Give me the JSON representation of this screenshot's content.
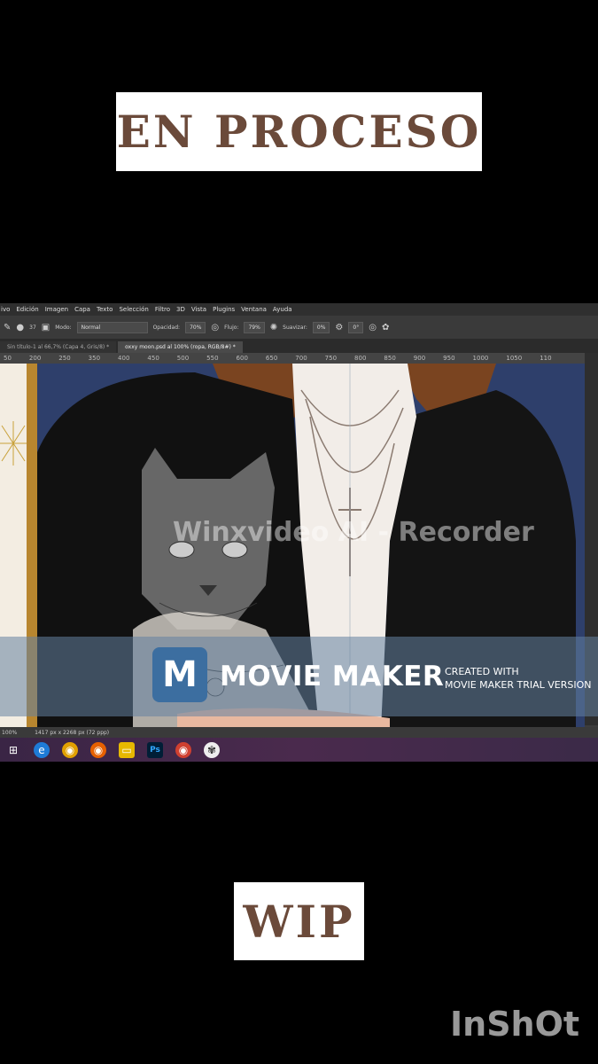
{
  "overlay": {
    "top_title": "EN PROCESO",
    "bottom_title": "WIP"
  },
  "photoshop": {
    "menu": [
      "ivo",
      "Edición",
      "Imagen",
      "Capa",
      "Texto",
      "Selección",
      "Filtro",
      "3D",
      "Vista",
      "Plugins",
      "Ventana",
      "Ayuda"
    ],
    "options": {
      "mode_label": "Modo:",
      "mode_value": "Normal",
      "opacity_label": "Opacidad:",
      "opacity_value": "70%",
      "flow_label": "Flujo:",
      "flow_value": "79%",
      "smoothing_label": "Suavizar:",
      "smoothing_value": "0%",
      "angle_value": "0°",
      "brush_size": "37"
    },
    "tabs": [
      {
        "label": "Sin título-1 al 66,7% (Capa 4, Gris/8) *",
        "active": false
      },
      {
        "label": "oxxy moon.psd al 100% (ropa, RGB/8#) *",
        "active": true
      }
    ],
    "ruler_ticks": [
      "50",
      "200",
      "250",
      "350",
      "400",
      "450",
      "500",
      "550",
      "600",
      "650",
      "700",
      "750",
      "800",
      "850",
      "900",
      "950",
      "1000",
      "1050",
      "110"
    ],
    "status": {
      "zoom": "100%",
      "doc_size": "1417 px x 2268 px (72 ppp)"
    }
  },
  "watermarks": {
    "recorder": "Winxvideo AI - Recorder",
    "brand": "MOVIE MAKER",
    "created_line1": "CREATED WITH",
    "created_line2": "MOVIE MAKER TRIAL VERSION",
    "inshot": "InShOt"
  },
  "colors": {
    "title_text": "#6b4a3a",
    "taskbar": "#4a2a4d",
    "banner": "#6482a0"
  }
}
